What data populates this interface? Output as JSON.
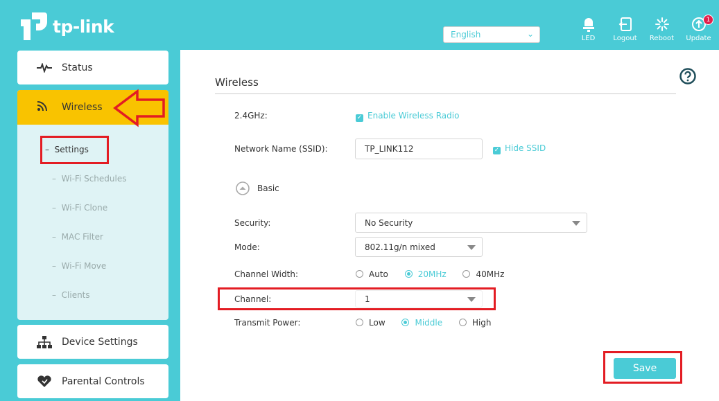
{
  "brand": {
    "name": "tp-link"
  },
  "header": {
    "language": "English",
    "icons": [
      {
        "name": "led-icon",
        "label": "LED"
      },
      {
        "name": "logout-icon",
        "label": "Logout"
      },
      {
        "name": "reboot-icon",
        "label": "Reboot"
      },
      {
        "name": "update-icon",
        "label": "Update",
        "badge": "1"
      }
    ]
  },
  "sidebar": {
    "status": "Status",
    "wireless": "Wireless",
    "submenu": [
      "Settings",
      "Wi-Fi Schedules",
      "Wi-Fi Clone",
      "MAC Filter",
      "Wi-Fi Move",
      "Clients"
    ],
    "device_settings": "Device Settings",
    "parental_controls": "Parental Controls"
  },
  "main": {
    "title": "Wireless",
    "band_label": "2.4GHz:",
    "enable_radio": "Enable Wireless Radio",
    "ssid_label": "Network Name (SSID):",
    "ssid_value": "TP_LINK112",
    "hide_ssid": "Hide SSID",
    "basic": "Basic",
    "security_label": "Security:",
    "security_value": "No Security",
    "mode_label": "Mode:",
    "mode_value": "802.11g/n mixed",
    "channel_width_label": "Channel Width:",
    "channel_width_options": [
      "Auto",
      "20MHz",
      "40MHz"
    ],
    "channel_width_selected": "20MHz",
    "channel_label": "Channel:",
    "channel_value": "1",
    "tx_power_label": "Transmit Power:",
    "tx_power_options": [
      "Low",
      "Middle",
      "High"
    ],
    "tx_power_selected": "Middle",
    "save": "Save"
  },
  "colors": {
    "accent": "#4acbd6",
    "active_menu": "#f9c300",
    "annotation": "#e31c23"
  }
}
